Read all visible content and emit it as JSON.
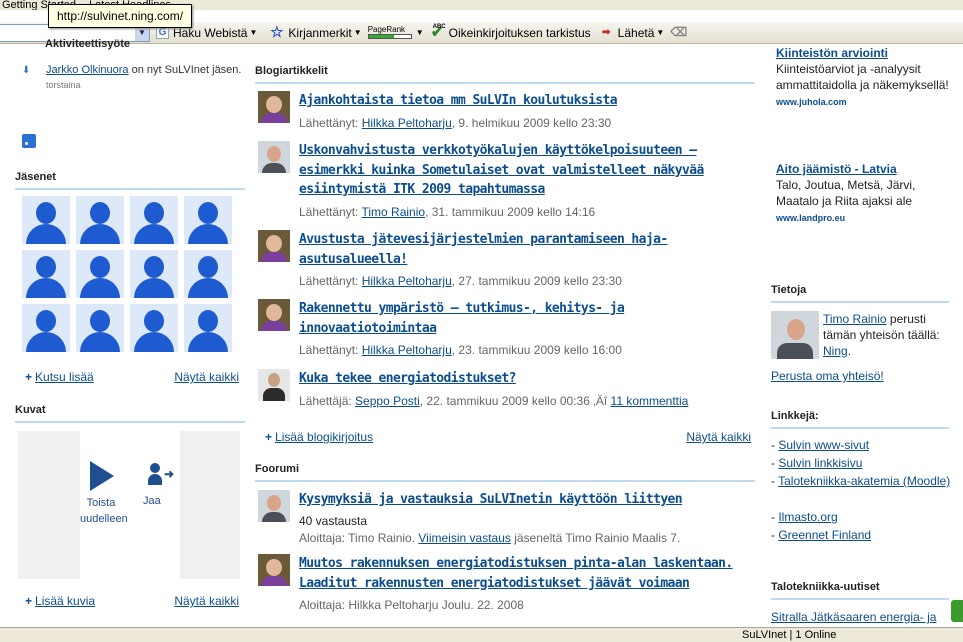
{
  "browser": {
    "bookmarks": [
      "Getting Started",
      "Latest Headlines"
    ],
    "tooltip": "http://sulvinet.ning.com/",
    "toolbar": {
      "search_label": "Haku Webistä",
      "bookmarks_label": "Kirjanmerkit",
      "pagerank_label": "PageRank",
      "spell_badge": "ABC",
      "spellcheck_label": "Oikeinkirjoituksen tarkistus",
      "send_label": "Lähetä"
    },
    "status_text": "SuLVInet | 1 Online"
  },
  "left": {
    "activity_title": "Aktiviteettisyöte",
    "activity": {
      "person": "Jarkko Olkinuora",
      "text": " on nyt SuLVInet jäsen.",
      "when": "torstaina"
    },
    "members_header": "Jäsenet",
    "member_count": 12,
    "invite_label": "Kutsu lisää",
    "members_show_all": "Näytä kaikki",
    "photos_header": "Kuvat",
    "replay_label": "Toista uudelleen",
    "share_label": "Jaa",
    "add_photos_label": "Lisää kuvia",
    "photos_show_all": "Näytä kaikki"
  },
  "blog": {
    "header": "Blogiartikkelit",
    "posts": [
      {
        "title": "Ajankohtaista tietoa mm SuLVIn koulutuksista",
        "prefix": "Lähettänyt: ",
        "author": "Hilkka Peltoharju",
        "date": ", 9. helmikuu 2009 kello 23:30"
      },
      {
        "title": "Uskonvahvistusta verkkotyökalujen käyttökelpoisuuteen – esimerkki kuinka Sometulaiset ovat valmistelleet näkyvää esiintymistä ITK 2009 tapahtumassa",
        "prefix": "Lähettänyt: ",
        "author": "Timo Rainio",
        "date": ", 31. tammikuu 2009 kello 14:16"
      },
      {
        "title": "Avustusta jätevesijärjestelmien parantamiseen haja-asutusalueella!",
        "prefix": "Lähettänyt: ",
        "author": "Hilkka Peltoharju",
        "date": ", 27. tammikuu 2009 kello 23:30"
      },
      {
        "title": "Rakennettu ympäristö – tutkimus-, kehitys- ja innovaatiotoimintaa",
        "prefix": "Lähettänyt: ",
        "author": "Hilkka Peltoharju",
        "date": ", 23. tammikuu 2009 kello 16:00"
      },
      {
        "title": "Kuka tekee energiatodistukset?",
        "prefix": "Lähettäjä: ",
        "author": "Seppo Posti",
        "date": ", 22. tammikuu 2009 kello 00:36 ‚Äî ",
        "comments": "11 kommenttia"
      }
    ],
    "add_label": "Lisää blogikirjoitus",
    "show_all": "Näytä kaikki"
  },
  "forum": {
    "header": "Foorumi",
    "topics": [
      {
        "title": "Kysymyksiä ja vastauksia SuLVInetin käyttöön liittyen",
        "replies": "40 vastausta",
        "meta_prefix": "Aloittaja: Timo Rainio. ",
        "meta_link": "Viimeisin vastaus",
        "meta_suffix": " jäseneltä Timo Rainio Maalis 7."
      },
      {
        "title": "Muutos rakennuksen energiatodistuksen pinta-alan laskentaan. Laaditut rakennusten energiatodistukset jäävät voimaan",
        "meta_prefix": "Aloittaja: Hilkka Peltoharju Joulu. 22. 2008"
      }
    ]
  },
  "right": {
    "ads": [
      {
        "title": "Kiinteistön arviointi",
        "text": "Kiinteistöarviot ja -analyysit ammattitaidolla ja näkemyksellä!",
        "url": "www.juhola.com"
      },
      {
        "title": "Aito jäämistö - Latvia",
        "text": "Talo, Joutua, Metsä, Järvi, Maatalo ja Riita ajaksi ale",
        "url": "www.landpro.eu"
      }
    ],
    "about_header": "Tietoja",
    "about_person": "Timo Rainio",
    "about_text": " perusti tämän yhteisön täällä: ",
    "about_site": "Ning",
    "about_end": ".",
    "create_label": "Perusta oma yhteisö!",
    "links_header": "Linkkejä:",
    "links": [
      "Sulvin www-sivut",
      "Sulvin linkkisivu",
      "Talotekniikka-akatemia (Moodle)",
      "",
      "Ilmasto.org",
      "Greennet Finland"
    ],
    "news_header": "Talotekniikka-uutiset",
    "news_item": "Sitralla Jätkäsaaren energia- ja"
  }
}
